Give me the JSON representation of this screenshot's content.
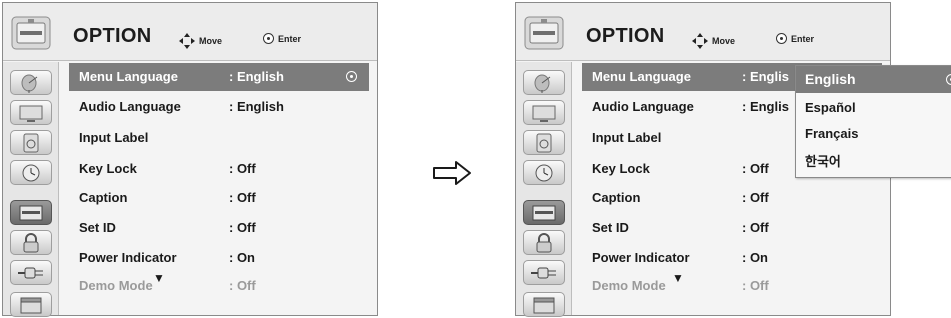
{
  "header": {
    "title": "OPTION",
    "move_label": "Move",
    "enter_label": "Enter"
  },
  "sidebar": {
    "icons": [
      "satellite-dish-icon",
      "tv-picture-icon",
      "speaker-icon",
      "clock-icon",
      "option-toolbox-icon",
      "lock-icon",
      "input-plug-icon",
      "media-clapper-icon"
    ],
    "selected": "option-toolbox-icon"
  },
  "left_menu": {
    "items": [
      {
        "label": "Menu Language",
        "value": ": English"
      },
      {
        "label": "Audio Language",
        "value": ": English"
      },
      {
        "label": "Input Label",
        "value": ""
      },
      {
        "label": "Key Lock",
        "value": ": Off"
      },
      {
        "label": "Caption",
        "value": ": Off"
      },
      {
        "label": "Set ID",
        "value": ": Off"
      },
      {
        "label": "Power Indicator",
        "value": ": On"
      },
      {
        "label": "Demo Mode",
        "value": ": Off"
      }
    ],
    "more_indicator": "▼"
  },
  "right_menu": {
    "items": [
      {
        "label": "Menu Language",
        "value": ": Englis"
      },
      {
        "label": "Audio Language",
        "value": ": Englis"
      },
      {
        "label": "Input Label",
        "value": ""
      },
      {
        "label": "Key Lock",
        "value": ": Off"
      },
      {
        "label": "Caption",
        "value": ": Off"
      },
      {
        "label": "Set ID",
        "value": ": Off"
      },
      {
        "label": "Power Indicator",
        "value": ": On"
      },
      {
        "label": "Demo Mode",
        "value": ": Off"
      }
    ],
    "more_indicator": "▼"
  },
  "language_dropdown": {
    "options": [
      "English",
      "Español",
      "Français",
      "한국어"
    ],
    "selected": "English"
  },
  "transition_arrow": "right-arrow-icon",
  "colors": {
    "highlight": "#7c7c7c",
    "disabled_text": "#9a9a9a",
    "panel_bg": "#f4f4f4"
  }
}
